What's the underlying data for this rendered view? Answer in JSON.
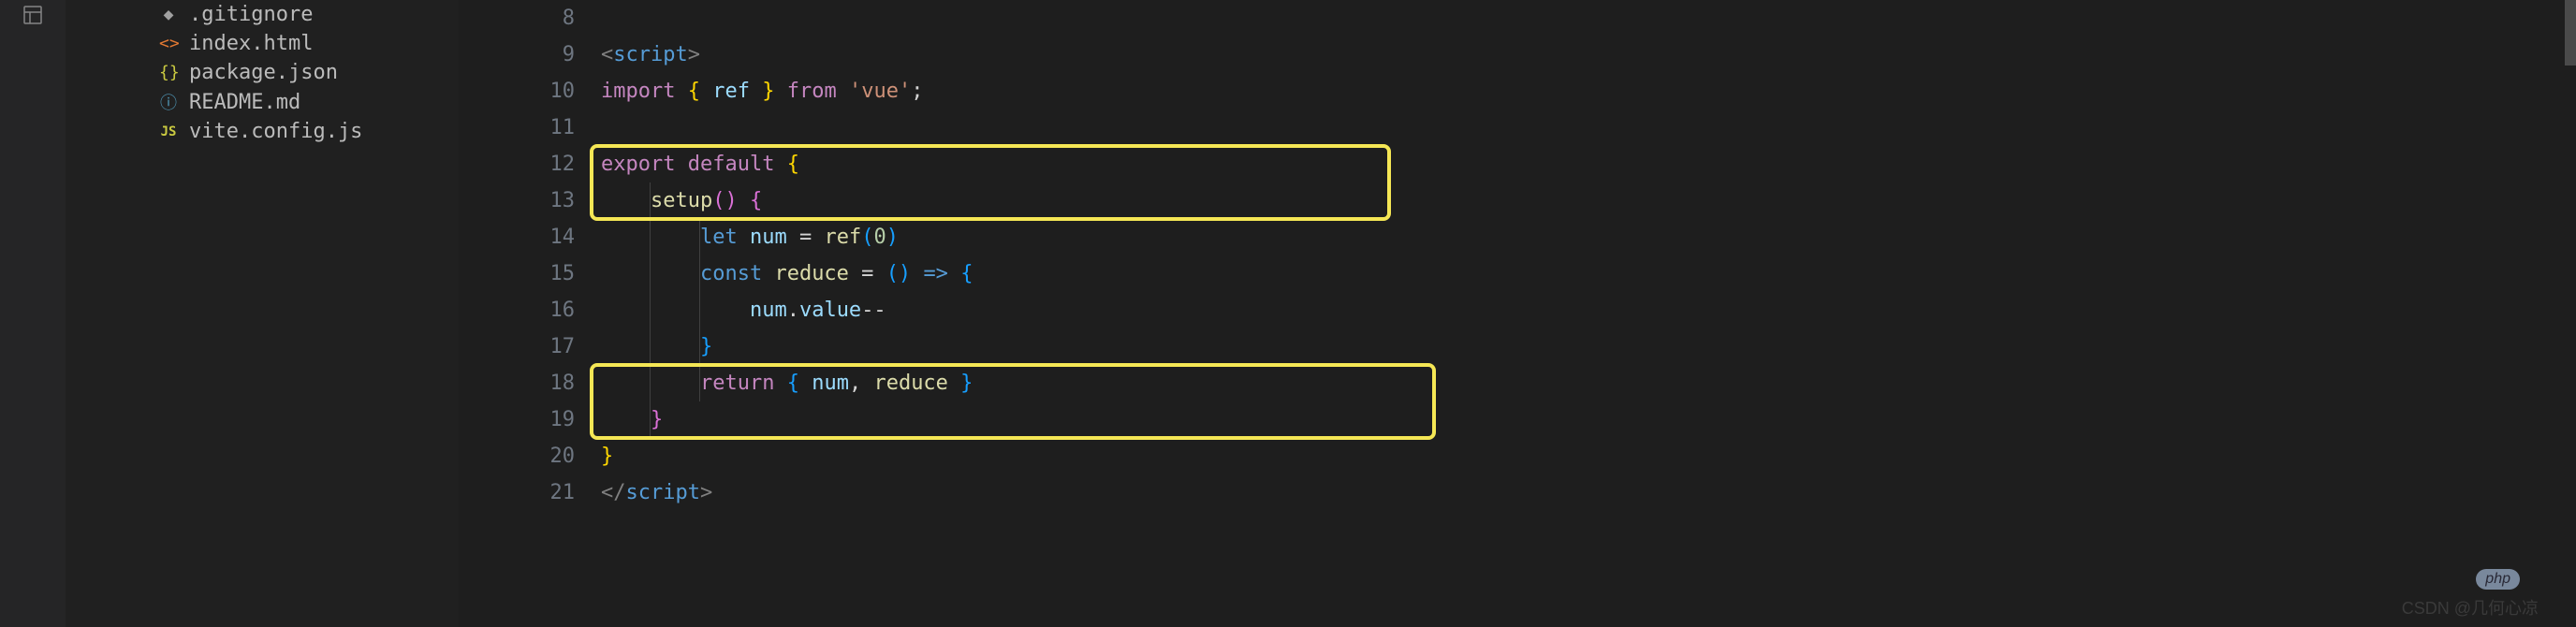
{
  "sidebar": {
    "files": [
      {
        "name": ".gitignore",
        "icon": "◆",
        "iconClass": "fi-git"
      },
      {
        "name": "index.html",
        "icon": "<>",
        "iconClass": "fi-html"
      },
      {
        "name": "package.json",
        "icon": "{}",
        "iconClass": "fi-json"
      },
      {
        "name": "README.md",
        "icon": "ⓘ",
        "iconClass": "fi-info"
      },
      {
        "name": "vite.config.js",
        "icon": "JS",
        "iconClass": "fi-js"
      }
    ]
  },
  "editor": {
    "line_start": 8,
    "line_end": 21,
    "lines": [
      {
        "n": 8,
        "tokens": []
      },
      {
        "n": 9,
        "tokens": [
          {
            "t": "<",
            "c": "tk-tag"
          },
          {
            "t": "script",
            "c": "tk-tagname"
          },
          {
            "t": ">",
            "c": "tk-tag"
          }
        ]
      },
      {
        "n": 10,
        "tokens": [
          {
            "t": "import",
            "c": "tk-keyword"
          },
          {
            "t": " ",
            "c": ""
          },
          {
            "t": "{ ",
            "c": "tk-brace"
          },
          {
            "t": "ref",
            "c": "tk-var"
          },
          {
            "t": " }",
            "c": "tk-brace"
          },
          {
            "t": " ",
            "c": ""
          },
          {
            "t": "from",
            "c": "tk-keyword"
          },
          {
            "t": " ",
            "c": ""
          },
          {
            "t": "'vue'",
            "c": "tk-string"
          },
          {
            "t": ";",
            "c": "tk-default"
          }
        ]
      },
      {
        "n": 11,
        "tokens": []
      },
      {
        "n": 12,
        "tokens": [
          {
            "t": "export",
            "c": "tk-keyword"
          },
          {
            "t": " ",
            "c": ""
          },
          {
            "t": "default",
            "c": "tk-keyword"
          },
          {
            "t": " ",
            "c": ""
          },
          {
            "t": "{",
            "c": "tk-brace"
          }
        ]
      },
      {
        "n": 13,
        "tokens": [
          {
            "t": "    ",
            "c": ""
          },
          {
            "t": "setup",
            "c": "tk-func"
          },
          {
            "t": "()",
            "c": "tk-paren-p"
          },
          {
            "t": " ",
            "c": ""
          },
          {
            "t": "{",
            "c": "tk-paren-p"
          }
        ]
      },
      {
        "n": 14,
        "tokens": [
          {
            "t": "        ",
            "c": ""
          },
          {
            "t": "let",
            "c": "tk-tagname"
          },
          {
            "t": " ",
            "c": ""
          },
          {
            "t": "num",
            "c": "tk-var"
          },
          {
            "t": " = ",
            "c": "tk-default"
          },
          {
            "t": "ref",
            "c": "tk-func"
          },
          {
            "t": "(",
            "c": "tk-paren-b"
          },
          {
            "t": "0",
            "c": "tk-num"
          },
          {
            "t": ")",
            "c": "tk-paren-b"
          }
        ]
      },
      {
        "n": 15,
        "tokens": [
          {
            "t": "        ",
            "c": ""
          },
          {
            "t": "const",
            "c": "tk-tagname"
          },
          {
            "t": " ",
            "c": ""
          },
          {
            "t": "reduce",
            "c": "tk-func"
          },
          {
            "t": " = ",
            "c": "tk-default"
          },
          {
            "t": "()",
            "c": "tk-paren-b"
          },
          {
            "t": " ",
            "c": ""
          },
          {
            "t": "=>",
            "c": "tk-tagname"
          },
          {
            "t": " ",
            "c": ""
          },
          {
            "t": "{",
            "c": "tk-paren-b"
          }
        ]
      },
      {
        "n": 16,
        "tokens": [
          {
            "t": "            ",
            "c": ""
          },
          {
            "t": "num",
            "c": "tk-var"
          },
          {
            "t": ".",
            "c": "tk-default"
          },
          {
            "t": "value",
            "c": "tk-var"
          },
          {
            "t": "--",
            "c": "tk-default"
          }
        ]
      },
      {
        "n": 17,
        "tokens": [
          {
            "t": "        ",
            "c": ""
          },
          {
            "t": "}",
            "c": "tk-paren-b"
          }
        ]
      },
      {
        "n": 18,
        "tokens": [
          {
            "t": "        ",
            "c": ""
          },
          {
            "t": "return",
            "c": "tk-keyword"
          },
          {
            "t": " ",
            "c": ""
          },
          {
            "t": "{ ",
            "c": "tk-paren-b"
          },
          {
            "t": "num",
            "c": "tk-var"
          },
          {
            "t": ", ",
            "c": "tk-default"
          },
          {
            "t": "reduce",
            "c": "tk-func"
          },
          {
            "t": " }",
            "c": "tk-paren-b"
          }
        ]
      },
      {
        "n": 19,
        "tokens": [
          {
            "t": "    ",
            "c": ""
          },
          {
            "t": "}",
            "c": "tk-paren-p"
          }
        ]
      },
      {
        "n": 20,
        "tokens": [
          {
            "t": "}",
            "c": "tk-brace"
          }
        ]
      },
      {
        "n": 21,
        "tokens": [
          {
            "t": "</",
            "c": "tk-tag"
          },
          {
            "t": "script",
            "c": "tk-tagname"
          },
          {
            "t": ">",
            "c": "tk-tag"
          }
        ]
      }
    ]
  },
  "watermark": "CSDN @几何心凉",
  "badge": "php"
}
